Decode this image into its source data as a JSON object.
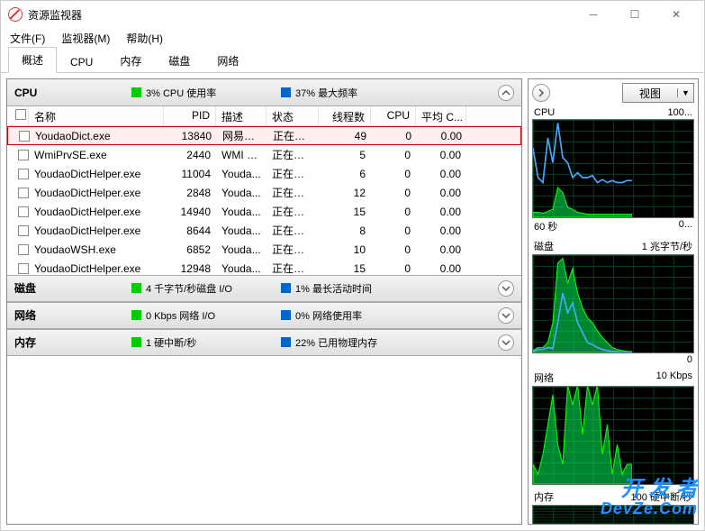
{
  "window": {
    "title": "资源监视器"
  },
  "menu": {
    "file": "文件(F)",
    "monitor": "监视器(M)",
    "help": "帮助(H)"
  },
  "tabs": {
    "overview": "概述",
    "cpu": "CPU",
    "memory": "内存",
    "disk": "磁盘",
    "network": "网络"
  },
  "sections": {
    "cpu": {
      "label": "CPU",
      "stat1": "3% CPU 使用率",
      "stat2": "37% 最大频率"
    },
    "disk": {
      "label": "磁盘",
      "stat1": "4 千字节/秒磁盘 I/O",
      "stat2": "1% 最长活动时间"
    },
    "network": {
      "label": "网络",
      "stat1": "0 Kbps 网络 I/O",
      "stat2": "0% 网络使用率"
    },
    "memory": {
      "label": "内存",
      "stat1": "1 硬中断/秒",
      "stat2": "22% 已用物理内存"
    }
  },
  "columns": {
    "name": "名称",
    "pid": "PID",
    "desc": "描述",
    "status": "状态",
    "threads": "线程数",
    "cpu": "CPU",
    "avg": "平均 C..."
  },
  "rows": [
    {
      "name": "YoudaoDict.exe",
      "pid": "13840",
      "desc": "网易有...",
      "status": "正在运行",
      "threads": "49",
      "cpu": "0",
      "avg": "0.00",
      "hl": true
    },
    {
      "name": "WmiPrvSE.exe",
      "pid": "2440",
      "desc": "WMI P...",
      "status": "正在运行",
      "threads": "5",
      "cpu": "0",
      "avg": "0.00"
    },
    {
      "name": "YoudaoDictHelper.exe",
      "pid": "11004",
      "desc": "Youda...",
      "status": "正在运行",
      "threads": "6",
      "cpu": "0",
      "avg": "0.00"
    },
    {
      "name": "YoudaoDictHelper.exe",
      "pid": "2848",
      "desc": "Youda...",
      "status": "正在运行",
      "threads": "12",
      "cpu": "0",
      "avg": "0.00"
    },
    {
      "name": "YoudaoDictHelper.exe",
      "pid": "14940",
      "desc": "Youda...",
      "status": "正在运行",
      "threads": "15",
      "cpu": "0",
      "avg": "0.00"
    },
    {
      "name": "YoudaoDictHelper.exe",
      "pid": "8644",
      "desc": "Youda...",
      "status": "正在运行",
      "threads": "8",
      "cpu": "0",
      "avg": "0.00"
    },
    {
      "name": "YoudaoWSH.exe",
      "pid": "6852",
      "desc": "Youda...",
      "status": "正在运行",
      "threads": "10",
      "cpu": "0",
      "avg": "0.00"
    },
    {
      "name": "YoudaoDictHelper.exe",
      "pid": "12948",
      "desc": "Youda...",
      "status": "正在运行",
      "threads": "15",
      "cpu": "0",
      "avg": "0.00"
    }
  ],
  "right": {
    "view": "视图",
    "charts": {
      "cpu": {
        "title": "CPU",
        "max": "100...",
        "bl": "60 秒",
        "br": "0..."
      },
      "disk": {
        "title": "磁盘",
        "max": "1 兆字节/秒",
        "br": "0"
      },
      "network": {
        "title": "网络",
        "max": "10 Kbps"
      },
      "memory": {
        "title": "内存",
        "max": "100 硬中断/秒"
      }
    }
  },
  "watermark": {
    "l1": "开 发 者",
    "l2": "DevZe.Com"
  },
  "chart_data": [
    {
      "type": "line",
      "title": "CPU",
      "ylim": [
        0,
        100
      ],
      "xlabel": "60 秒",
      "series": [
        {
          "name": "green",
          "values": [
            5,
            5,
            4,
            6,
            8,
            30,
            25,
            10,
            8,
            5,
            4,
            3,
            3,
            3,
            3,
            3,
            3,
            3,
            3,
            3
          ]
        },
        {
          "name": "blue",
          "values": [
            70,
            40,
            35,
            80,
            55,
            95,
            60,
            55,
            40,
            45,
            40,
            40,
            42,
            35,
            38,
            35,
            37,
            35,
            35,
            37
          ]
        }
      ]
    },
    {
      "type": "area",
      "title": "磁盘",
      "ylim": [
        0,
        1
      ],
      "series": [
        {
          "name": "green",
          "values": [
            0.02,
            0.05,
            0.05,
            0.1,
            0.3,
            0.9,
            0.95,
            0.7,
            0.85,
            0.6,
            0.45,
            0.35,
            0.3,
            0.22,
            0.15,
            0.1,
            0.05,
            0.03,
            0.02,
            0.01
          ]
        },
        {
          "name": "blue",
          "values": [
            0.01,
            0.03,
            0.03,
            0.05,
            0.04,
            0.3,
            0.6,
            0.4,
            0.5,
            0.3,
            0.2,
            0.1,
            0.08,
            0.05,
            0.03,
            0.02,
            0.01,
            0.01,
            0,
            0
          ]
        }
      ]
    },
    {
      "type": "area",
      "title": "网络",
      "ylim": [
        0,
        10
      ],
      "series": [
        {
          "name": "green",
          "values": [
            2,
            1,
            3,
            6,
            9,
            4,
            2,
            10,
            8,
            10,
            5,
            10,
            8,
            10,
            3,
            6,
            1,
            4,
            1,
            2
          ]
        }
      ]
    }
  ]
}
